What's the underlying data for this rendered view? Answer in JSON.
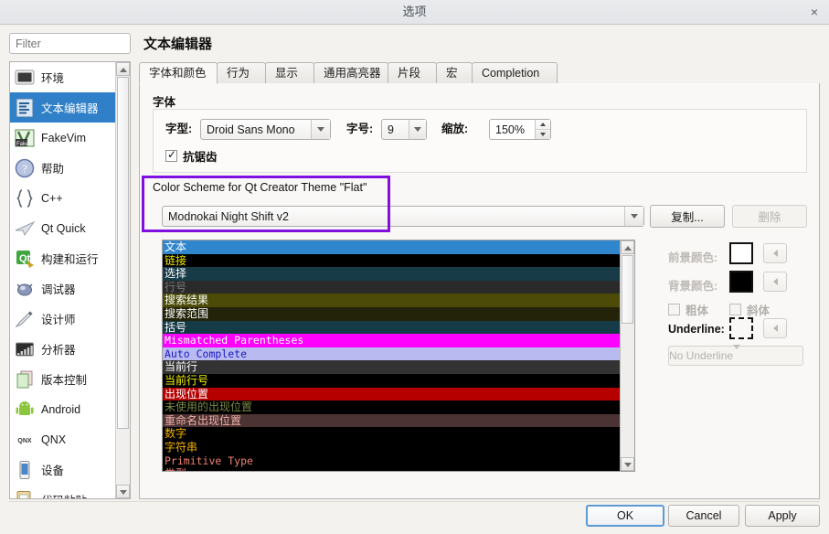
{
  "window": {
    "title": "选项",
    "close_label": "×"
  },
  "sidebar": {
    "filter_placeholder": "Filter",
    "items": [
      {
        "label": "环境",
        "icon": "monitor-icon",
        "selected": false
      },
      {
        "label": "文本编辑器",
        "icon": "text-editor-icon",
        "selected": true
      },
      {
        "label": "FakeVim",
        "icon": "fakevim-icon",
        "selected": false
      },
      {
        "label": "帮助",
        "icon": "help-icon",
        "selected": false
      },
      {
        "label": "C++",
        "icon": "braces-icon",
        "selected": false
      },
      {
        "label": "Qt Quick",
        "icon": "qt-quick-icon",
        "selected": false
      },
      {
        "label": "构建和运行",
        "icon": "build-run-icon",
        "selected": false
      },
      {
        "label": "调试器",
        "icon": "debugger-icon",
        "selected": false
      },
      {
        "label": "设计师",
        "icon": "designer-icon",
        "selected": false
      },
      {
        "label": "分析器",
        "icon": "analyzer-icon",
        "selected": false
      },
      {
        "label": "版本控制",
        "icon": "version-control-icon",
        "selected": false
      },
      {
        "label": "Android",
        "icon": "android-icon",
        "selected": false
      },
      {
        "label": "QNX",
        "icon": "qnx-icon",
        "selected": false
      },
      {
        "label": "设备",
        "icon": "device-icon",
        "selected": false
      },
      {
        "label": "代码粘贴",
        "icon": "code-paste-icon",
        "selected": false
      }
    ]
  },
  "main": {
    "page_title": "文本编辑器",
    "tabs": [
      {
        "label": "字体和颜色",
        "active": true
      },
      {
        "label": "行为",
        "active": false
      },
      {
        "label": "显示",
        "active": false
      },
      {
        "label": "通用高亮器",
        "active": false
      },
      {
        "label": "片段",
        "active": false
      },
      {
        "label": "宏",
        "active": false
      },
      {
        "label": "Completion",
        "active": false
      }
    ],
    "font_group": {
      "title": "字体",
      "family_label": "字型:",
      "family_value": "Droid Sans Mono",
      "size_label": "字号:",
      "size_value": "9",
      "zoom_label": "缩放:",
      "zoom_value": "150%",
      "antialias_label": "抗锯齿",
      "antialias_checked": true
    },
    "scheme": {
      "label": "Color Scheme for Qt Creator Theme \"Flat\"",
      "value": "Modnokai Night Shift v2",
      "copy_button": "复制...",
      "delete_button": "删除",
      "delete_disabled": true,
      "highlight_color": "#7f10e0"
    },
    "color_controls": {
      "foreground_label": "前景颜色:",
      "foreground_color": "#ffffff",
      "background_label": "背景颜色:",
      "background_color": "#000000",
      "bold_label": "粗体",
      "italic_label": "斜体",
      "underline_label": "Underline:",
      "underline_style_value": "No Underline"
    }
  },
  "color_list": [
    {
      "name": "文本",
      "fg": "#ffffff",
      "bg": "#2f86cd",
      "mono": false
    },
    {
      "name": "链接",
      "fg": "#e8e800",
      "bg": "#000000",
      "mono": false
    },
    {
      "name": "选择",
      "fg": "#ffffff",
      "bg": "#173b47",
      "mono": false
    },
    {
      "name": "行号",
      "fg": "#7a7a7a",
      "bg": "#2a2a2a",
      "mono": false
    },
    {
      "name": "搜索结果",
      "fg": "#ffffff",
      "bg": "#4c4c08",
      "mono": false
    },
    {
      "name": "搜索范围",
      "fg": "#ffffff",
      "bg": "#23230a",
      "mono": false
    },
    {
      "name": "括号",
      "fg": "#ffffff",
      "bg": "#153b47",
      "mono": false
    },
    {
      "name": "Mismatched Parentheses",
      "fg": "#ffffff",
      "bg": "#ff00ff",
      "mono": true
    },
    {
      "name": "Auto Complete",
      "fg": "#1a1ac0",
      "bg": "#b9bbf0",
      "mono": true
    },
    {
      "name": "当前行",
      "fg": "#ffffff",
      "bg": "#333333",
      "mono": false
    },
    {
      "name": "当前行号",
      "fg": "#f2f200",
      "bg": "#000000",
      "mono": false
    },
    {
      "name": "出现位置",
      "fg": "#ffffff",
      "bg": "#b60000",
      "mono": false
    },
    {
      "name": "未使用的出现位置",
      "fg": "#778844",
      "bg": "#000000",
      "mono": false
    },
    {
      "name": "重命名出现位置",
      "fg": "#f0b0a8",
      "bg": "#4c3333",
      "mono": false
    },
    {
      "name": "数字",
      "fg": "#f2b200",
      "bg": "#000000",
      "mono": false
    },
    {
      "name": "字符串",
      "fg": "#f2b200",
      "bg": "#000000",
      "mono": false
    },
    {
      "name": "Primitive Type",
      "fg": "#f08070",
      "bg": "#000000",
      "mono": true
    },
    {
      "name": "类型",
      "fg": "#f08070",
      "bg": "#000000",
      "mono": false
    }
  ],
  "footer": {
    "ok": "OK",
    "cancel": "Cancel",
    "apply": "Apply"
  }
}
